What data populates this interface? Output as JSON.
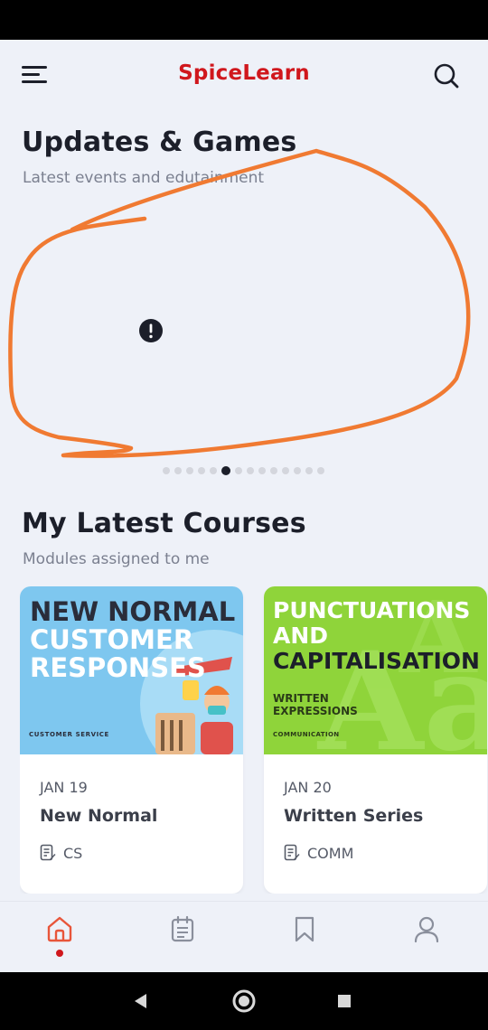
{
  "app": {
    "title": "SpiceLearn",
    "brand_color": "#d0171d"
  },
  "icons": {
    "menu": "menu-icon",
    "search": "search-icon",
    "alert": "alert-icon"
  },
  "updates": {
    "title": "Updates & Games",
    "subtitle": "Latest events and edutainment",
    "carousel": {
      "total_pages": 14,
      "active_index": 5
    }
  },
  "courses": {
    "title": "My Latest Courses",
    "subtitle": "Modules assigned to me",
    "items": [
      {
        "date": "JAN 19",
        "name": "New Normal",
        "tag": "CS",
        "thumb": {
          "line1": "NEW NORMAL",
          "line2": "CUSTOMER",
          "line3": "RESPONSES",
          "caption": "CUSTOMER SERVICE",
          "bg": "#7ec7ef"
        }
      },
      {
        "date": "JAN 20",
        "name": "Written Series",
        "tag": "COMM",
        "thumb": {
          "line1": "PUNCTUATIONS",
          "line2": "AND",
          "line3": "CAPITALISATION",
          "line4": "WRITTEN",
          "line5": "EXPRESSIONS",
          "caption": "COMMUNICATION",
          "bg": "#8fd43a"
        }
      }
    ]
  },
  "bottom_nav": {
    "items": [
      "home-icon",
      "calendar-icon",
      "bookmark-icon",
      "profile-icon"
    ],
    "active": "home-icon"
  },
  "system_nav": [
    "back-icon",
    "home-circle-icon",
    "recents-icon"
  ]
}
